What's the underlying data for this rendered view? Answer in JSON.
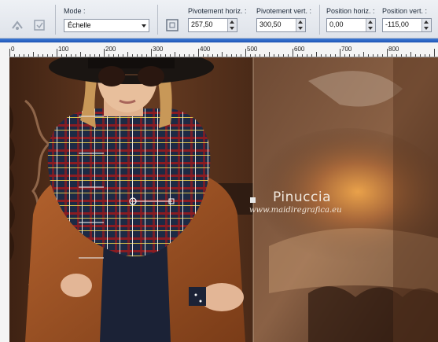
{
  "toolbar": {
    "mode_label": "Mode :",
    "mode_value": "Échelle",
    "pivot_h_label": "Pivotement horiz. :",
    "pivot_h_value": "257,50",
    "pivot_v_label": "Pivotement vert. :",
    "pivot_v_value": "300,50",
    "pos_h_label": "Position horiz. :",
    "pos_h_value": "0,00",
    "pos_v_label": "Position vert. :",
    "pos_v_value": "-115,00"
  },
  "ruler": {
    "marks": [
      "0",
      "100",
      "200",
      "300",
      "400",
      "500",
      "600",
      "700",
      "800"
    ]
  },
  "canvas": {
    "watermark_title": "Pinuccia",
    "watermark_url": "www.maidiregrafica.eu"
  },
  "colors": {
    "accent_blue": "#2a63c4",
    "canvas_brown": "#5a3520"
  }
}
